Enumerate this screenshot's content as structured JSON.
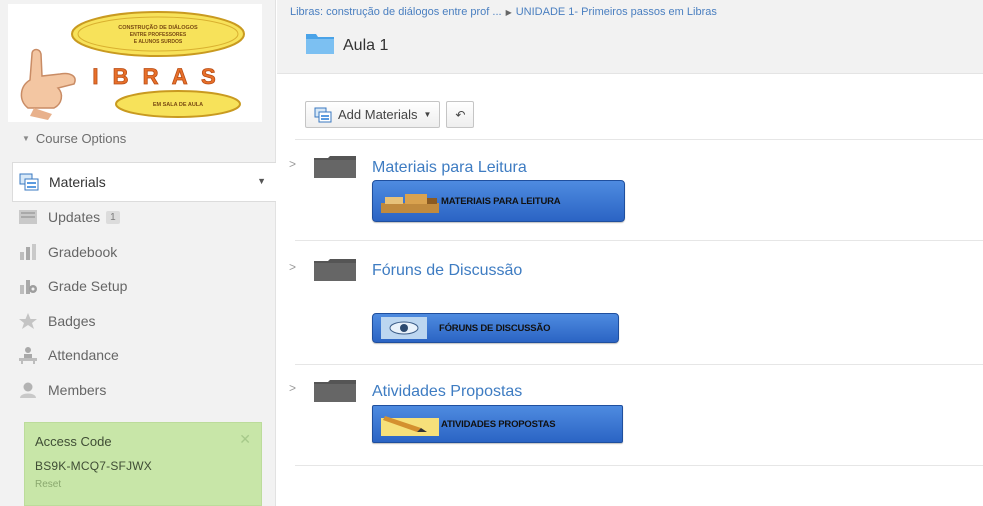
{
  "logo": {
    "top_text": "CONSTRUÇÃO DE DIÁLOGOS ENTRE PROFESSORES E ALUNOS SURDOS",
    "brand": "I B R A S",
    "bottom_text": "EM SALA DE AULA"
  },
  "sidebar": {
    "course_options": "Course Options",
    "items": [
      {
        "label": "Materials",
        "icon": "materials-icon",
        "active": true
      },
      {
        "label": "Updates",
        "icon": "updates-icon",
        "count": "1"
      },
      {
        "label": "Gradebook",
        "icon": "gradebook-icon"
      },
      {
        "label": "Grade Setup",
        "icon": "grade-setup-icon"
      },
      {
        "label": "Badges",
        "icon": "badges-icon"
      },
      {
        "label": "Attendance",
        "icon": "attendance-icon"
      },
      {
        "label": "Members",
        "icon": "members-icon"
      }
    ],
    "access_code": {
      "title": "Access Code",
      "code": "BS9K-MCQ7-SFJWX",
      "reset": "Reset"
    }
  },
  "header": {
    "breadcrumb": [
      "Libras: construção de diálogos entre prof ...",
      "UNIDADE 1- Primeiros passos em Libras"
    ],
    "title": "Aula 1"
  },
  "toolbar": {
    "add_materials": "Add Materials",
    "undo_icon": "undo-icon"
  },
  "folders": [
    {
      "title": "Materiais para Leitura",
      "banner": "MATERIAIS PARA LEITURA"
    },
    {
      "title": "Fóruns de Discussão",
      "banner": "FÓRUNS DE DISCUSSÃO"
    },
    {
      "title": "Atividades Propostas",
      "banner": "ATIVIDADES PROPOSTAS"
    }
  ],
  "colors": {
    "accent": "#3e7cc2",
    "sidebar_bg": "#f2f2f2",
    "access_bg": "#c8e6a8",
    "banner_blue": "#2b64c4"
  }
}
